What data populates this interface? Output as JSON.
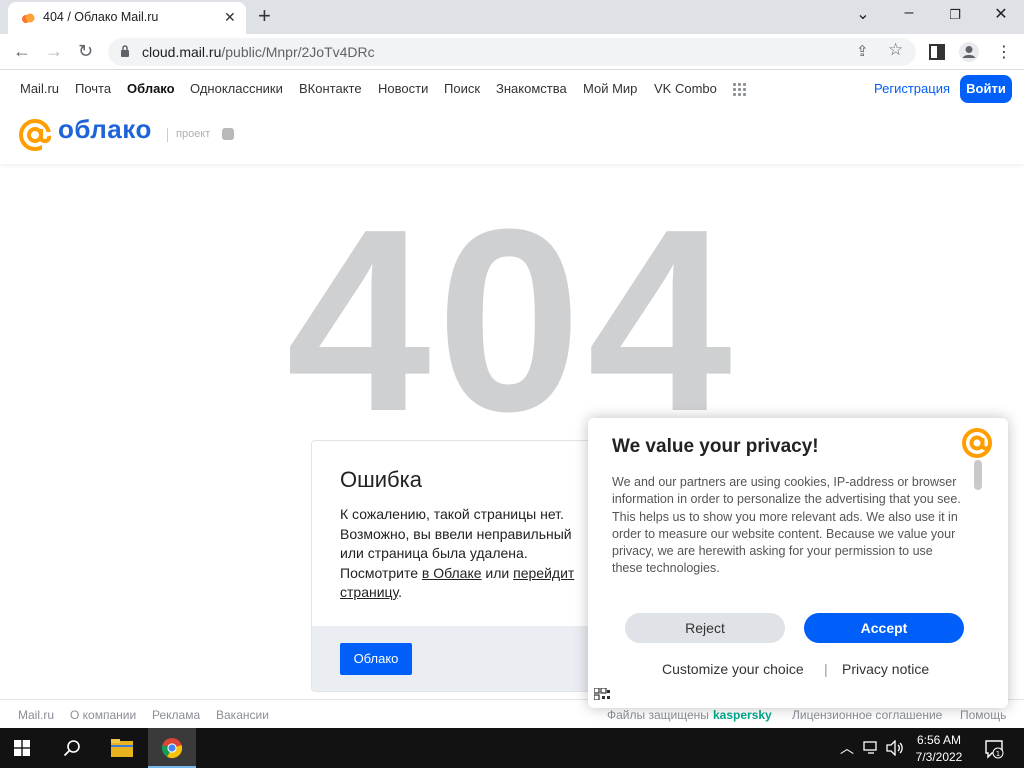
{
  "browser": {
    "tab_title": "404 / Облако Mail.ru",
    "url_host": "cloud.mail.ru",
    "url_path": "/public/Mnpr/2JoTv4DRc"
  },
  "mailnav": {
    "links": [
      "Mail.ru",
      "Почта",
      "Облако",
      "Одноклассники",
      "ВКонтакте",
      "Новости",
      "Поиск",
      "Знакомства",
      "Мой Мир",
      "VK Combo"
    ],
    "register_label": "Регистрация",
    "login_label": "Войти"
  },
  "cloudheader": {
    "logo_text": "облако",
    "project_label": "проект"
  },
  "error": {
    "code": "404",
    "title": "Ошибка",
    "line1": "К сожалению, такой страницы нет.",
    "line2": "Возможно, вы ввели неправильный",
    "line3": "или страница была удалена.",
    "line4_pre": "Посмотрите ",
    "link1": "в Облаке",
    "line4_mid": " или ",
    "link2": "перейдит",
    "link2_cont": "страницу",
    "line4_end": ".",
    "button_label": "Облако"
  },
  "footer": {
    "left_links": [
      "Mail.ru",
      "О компании",
      "Реклама",
      "Вакансии"
    ],
    "protected_label": "Файлы защищены",
    "kaspersky": "kaspersky",
    "license": "Лицензионное соглашение",
    "help": "Помощь"
  },
  "privacy": {
    "title": "We value your privacy!",
    "body": "We and our partners are using cookies, IP-address or browser information in order to personalize the advertising that you see. This helps us to show you more relevant ads. We also use it in order to measure our website content. Because we value your privacy, we are herewith asking for your permission to use these technologies.",
    "reject_label": "Reject",
    "accept_label": "Accept",
    "customize_label": "Customize your choice",
    "separator": "|",
    "notice_label": "Privacy notice"
  },
  "taskbar": {
    "time": "6:56 AM",
    "date": "7/3/2022",
    "notification_count": "1"
  },
  "colors": {
    "accent": "#005ff9",
    "cloud_orange": "#ff9e00",
    "code_gray": "#cfd0d2"
  }
}
